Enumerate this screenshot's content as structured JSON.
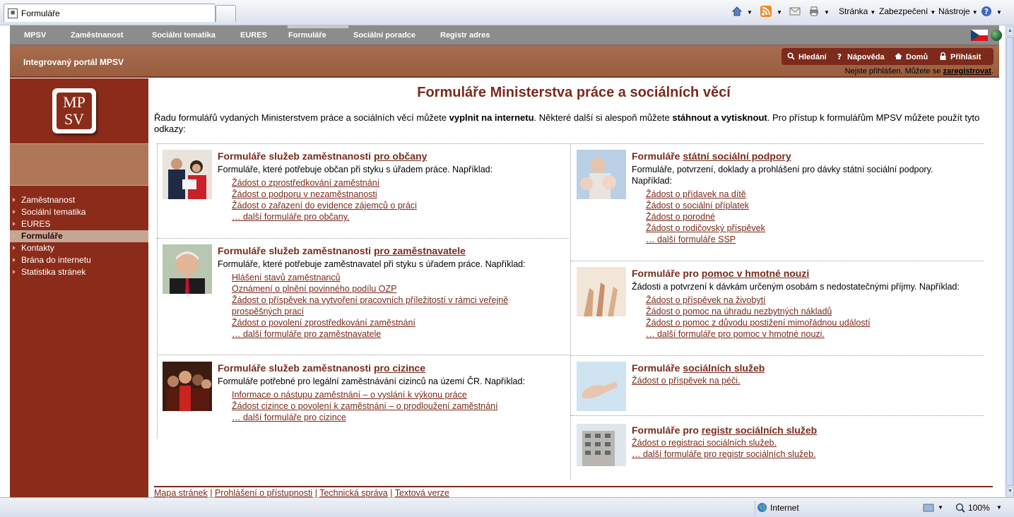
{
  "browser": {
    "tab_title": "Formuláře",
    "commands": [
      "Stránka",
      "Zabezpečení",
      "Nástroje"
    ],
    "status_zone": "Internet",
    "zoom": "100%"
  },
  "nav": {
    "items": [
      "MPSV",
      "Zaměstnanost",
      "Sociální tematika",
      "EURES",
      "Formuláře",
      "Sociální poradce",
      "Registr adres"
    ],
    "active": "Formuláře"
  },
  "header": {
    "portal_title": "Integrovaný portál MPSV",
    "tools": [
      "Hledání",
      "Nápověda",
      "Domů",
      "Přihlásit"
    ],
    "login_prefix": "Nejste přihlášen. Můžete se ",
    "login_link": "zaregistrovat",
    "login_suffix": "."
  },
  "logo": {
    "line1": "MP",
    "line2": "SV"
  },
  "sidebar": {
    "items": [
      {
        "label": "Zaměstnanost"
      },
      {
        "label": "Sociální tematika"
      },
      {
        "label": "EURES"
      },
      {
        "label": "Formuláře",
        "active": true
      },
      {
        "label": "Kontakty"
      },
      {
        "label": "Brána do internetu"
      },
      {
        "label": "Statistika stránek"
      }
    ]
  },
  "page": {
    "title": "Formuláře Ministerstva práce a sociálních věcí",
    "intro_1": "Řadu formulářů vydaných Ministerstvem práce a sociálních věcí můžete ",
    "intro_b1": "vyplnit na internetu",
    "intro_2": ". Některé další si alespoň můžete ",
    "intro_b2": "stáhnout a vytisknout",
    "intro_3": ". Pro přístup k formulářům MPSV můžete použít tyto odkazy:"
  },
  "boxes": {
    "obcane": {
      "title": "Formuláře služeb zaměstnanosti ",
      "link": "pro občany",
      "desc": "Formuláře, které potřebuje občan při styku s úřadem práce. Například:",
      "links": [
        "Žádost o zprostředkování zaměstnání",
        "Žádost o podporu v nezaměstnanosti",
        "Žádost o zařazení do evidence zájemců o práci",
        "… další formuláře pro občany."
      ]
    },
    "zamestnavatele": {
      "title": "Formuláře služeb zaměstnanosti ",
      "link": "pro zaměstnavatele",
      "desc": "Formuláře, které potřebuje zaměstnavatel při styku s úřadem práce. Například:",
      "links": [
        "Hlášení stavů zaměstnanců",
        "Oznámení o plnění povinného podílu OZP",
        "Žádost o příspěvek na vytvoření pracovních příležitostí v rámci veřejně prospěšných prací",
        "Žádost o povolení zprostředkování zaměstnání",
        "… další formuláře pro zaměstnavatele"
      ]
    },
    "cizince": {
      "title": "Formuláře služeb zaměstnanosti ",
      "link": "pro cizince",
      "desc": "Formuláře potřebné pro legální zaměstnávání cizinců na území ČR. Například:",
      "links": [
        "Informace o nástupu zaměstnání – o vyslání k výkonu práce",
        "Žádost cizince o povolení k zaměstnání – o prodloužení zaměstnání",
        "… další formuláře pro cizince"
      ]
    },
    "ssp": {
      "title": "Formuláře ",
      "link": "státní sociální podpory",
      "desc1": "Formuláře, potvrzení, doklady a prohlášení pro dávky státní sociální podpory.",
      "desc2": "Například:",
      "links": [
        "Žádost o přídavek na dítě",
        "Žádost o sociální příplatek",
        "Žádost o porodné",
        "Žádost o rodičovský příspěvek",
        "… další formuláře SSP"
      ]
    },
    "hmotna": {
      "title": "Formuláře pro ",
      "link": "pomoc v hmotné nouzi",
      "desc": "Žádosti a potvrzení k dávkám určeným osobám s nedostatečnými příjmy. Například:",
      "links": [
        "Žádost o příspěvek na živobytí",
        "Žádost o pomoc na úhradu nezbytných nákladů",
        "Žádost o pomoc z důvodu postižení mimořádnou událostí",
        "… další formuláře pro pomoc v hmotné nouzi."
      ]
    },
    "socsluzby": {
      "title": "Formuláře ",
      "link": "sociálních služeb",
      "links": [
        "Žádost o příspěvek na péči."
      ]
    },
    "registr": {
      "title": "Formuláře pro ",
      "link": "registr sociálních služeb",
      "links": [
        "Žádost o registraci sociálních služeb.",
        "… další formuláře pro registr sociálních služeb."
      ]
    }
  },
  "footer": {
    "links": [
      "Mapa stránek",
      "Prohlášení o přístupnosti",
      "Technická správa",
      "Textová verze"
    ]
  }
}
